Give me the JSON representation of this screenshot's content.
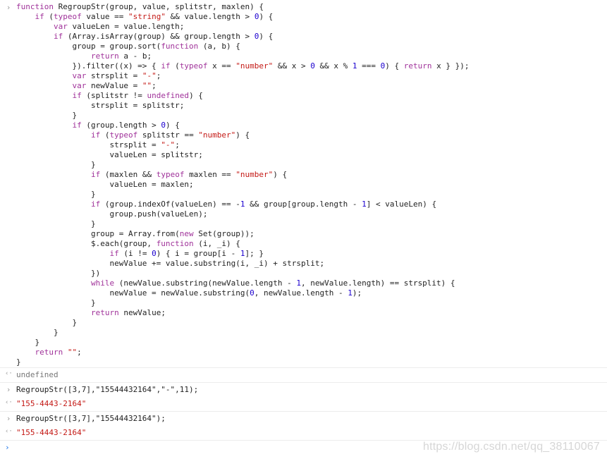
{
  "console": {
    "input_arrow": "›",
    "output_arrow": "‹·",
    "entries": [
      {
        "code": [
          "function RegroupStr(group, value, splitstr, maxlen) {",
          "    if (typeof value == \"string\" && value.length > 0) {",
          "        var valueLen = value.length;",
          "        if (Array.isArray(group) && group.length > 0) {",
          "            group = group.sort(function (a, b) {",
          "                return a - b;",
          "            }).filter((x) => { if (typeof x == \"number\" && x > 0 && x % 1 === 0) { return x } });",
          "            var strsplit = \"-\";",
          "            var newValue = \"\";",
          "            if (splitstr != undefined) {",
          "                strsplit = splitstr;",
          "            }",
          "            if (group.length > 0) {",
          "                if (typeof splitstr == \"number\") {",
          "                    strsplit = \"-\";",
          "                    valueLen = splitstr;",
          "                }",
          "                if (maxlen && typeof maxlen == \"number\") {",
          "                    valueLen = maxlen;",
          "                }",
          "                if (group.indexOf(valueLen) == -1 && group[group.length - 1] < valueLen) {",
          "                    group.push(valueLen);",
          "                }",
          "                group = Array.from(new Set(group));",
          "                $.each(group, function (i, _i) {",
          "                    if (i != 0) { i = group[i - 1]; }",
          "                    newValue += value.substring(i, _i) + strsplit;",
          "                })",
          "                while (newValue.substring(newValue.length - 1, newValue.length) == strsplit) {",
          "                    newValue = newValue.substring(0, newValue.length - 1);",
          "                }",
          "                return newValue;",
          "            }",
          "        }",
          "    }",
          "    return \"\";",
          "}"
        ],
        "result": "undefined"
      },
      {
        "code": [
          "RegroupStr([3,7],\"15544432164\",\"-\",11);"
        ],
        "result": "\"155-4443-2164\""
      },
      {
        "code": [
          "RegroupStr([3,7],\"15544432164\");"
        ],
        "result": "\"155-4443-2164\""
      }
    ]
  },
  "watermark": "https://blog.csdn.net/qq_38110067",
  "colors": {
    "keyword": "#a0329a",
    "string": "#c41a16",
    "number": "#1c00cf",
    "prompt": "#1a73e8"
  },
  "icons": {
    "input_prompt": "chevron-right-icon",
    "output_prompt": "chevron-left-icon"
  }
}
